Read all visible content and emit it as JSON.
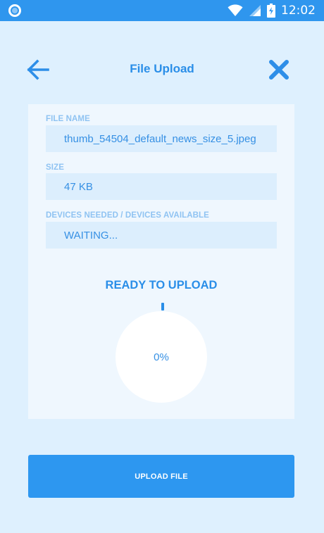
{
  "status_bar": {
    "time": "12:02",
    "icons": [
      "notification-ring-icon",
      "wifi-icon",
      "signal-icon",
      "battery-charging-icon"
    ]
  },
  "app_bar": {
    "title": "File Upload",
    "back_icon": "arrow-left-icon",
    "close_icon": "close-x-icon"
  },
  "fields": {
    "file_name": {
      "label": "FILE NAME",
      "value": "thumb_54504_default_news_size_5.jpeg"
    },
    "size": {
      "label": "SIZE",
      "value": "47 KB"
    },
    "devices": {
      "label": "DEVICES NEEDED / DEVICES AVAILABLE",
      "value": "WAITING..."
    }
  },
  "progress": {
    "heading": "READY TO UPLOAD",
    "percent_text": "0%",
    "value": 0
  },
  "actions": {
    "upload_label": "UPLOAD FILE"
  },
  "colors": {
    "accent": "#2d97f0",
    "background": "#def0fe",
    "card": "#eff7fe",
    "field": "#dceefd"
  }
}
